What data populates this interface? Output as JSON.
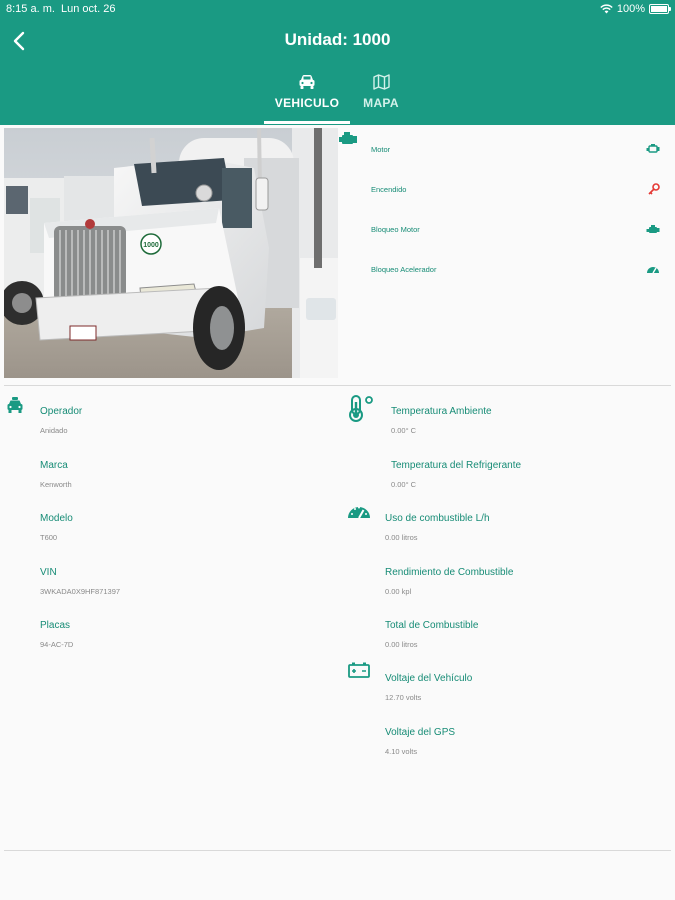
{
  "status_bar": {
    "time": "8:15 a. m.",
    "date": "Lun oct. 26",
    "battery": "100%"
  },
  "header": {
    "title": "Unidad: 1000"
  },
  "tabs": [
    {
      "label": "VEHICULO",
      "icon": "truck-icon",
      "active": true
    },
    {
      "label": "MAPA",
      "icon": "map-icon",
      "active": false
    }
  ],
  "photo": {
    "alt": "truck-photo",
    "unit_badge": "1000"
  },
  "engine_status": [
    {
      "label": "Motor",
      "icon": "engine-icon",
      "color": "#1a9a83"
    },
    {
      "label": "Encendido",
      "icon": "key-icon",
      "color": "#e53935"
    },
    {
      "label": "Bloqueo Motor",
      "icon": "engine-lock-icon",
      "color": "#1a9a83"
    },
    {
      "label": "Bloqueo Acelerador",
      "icon": "gauge-icon",
      "color": "#1a9a83"
    }
  ],
  "vehicle_info": [
    {
      "label": "Operador",
      "value": "Anidado"
    },
    {
      "label": "Marca",
      "value": "Kenworth"
    },
    {
      "label": "Modelo",
      "value": "T600"
    },
    {
      "label": "VIN",
      "value": "3WKADA0X9HF871397"
    },
    {
      "label": "Placas",
      "value": "94-AC-7D"
    }
  ],
  "sensors": {
    "temperature": [
      {
        "label": "Temperatura Ambiente",
        "value": "0.00° C"
      },
      {
        "label": "Temperatura del Refrigerante",
        "value": "0.00° C"
      }
    ],
    "fuel": [
      {
        "label": "Uso de combustible L/h",
        "value": "0.00 litros"
      },
      {
        "label": "Rendimiento de Combustible",
        "value": "0.00 kpl"
      },
      {
        "label": "Total de Combustible",
        "value": "0.00 litros"
      }
    ],
    "voltage": [
      {
        "label": "Voltaje del Vehículo",
        "value": "12.70 volts"
      },
      {
        "label": "Voltaje del GPS",
        "value": "4.10 volts"
      }
    ]
  },
  "colors": {
    "primary": "#1a9a83",
    "accent_red": "#e53935",
    "label_green": "#178c76",
    "value_gray": "#8a8a8a"
  }
}
